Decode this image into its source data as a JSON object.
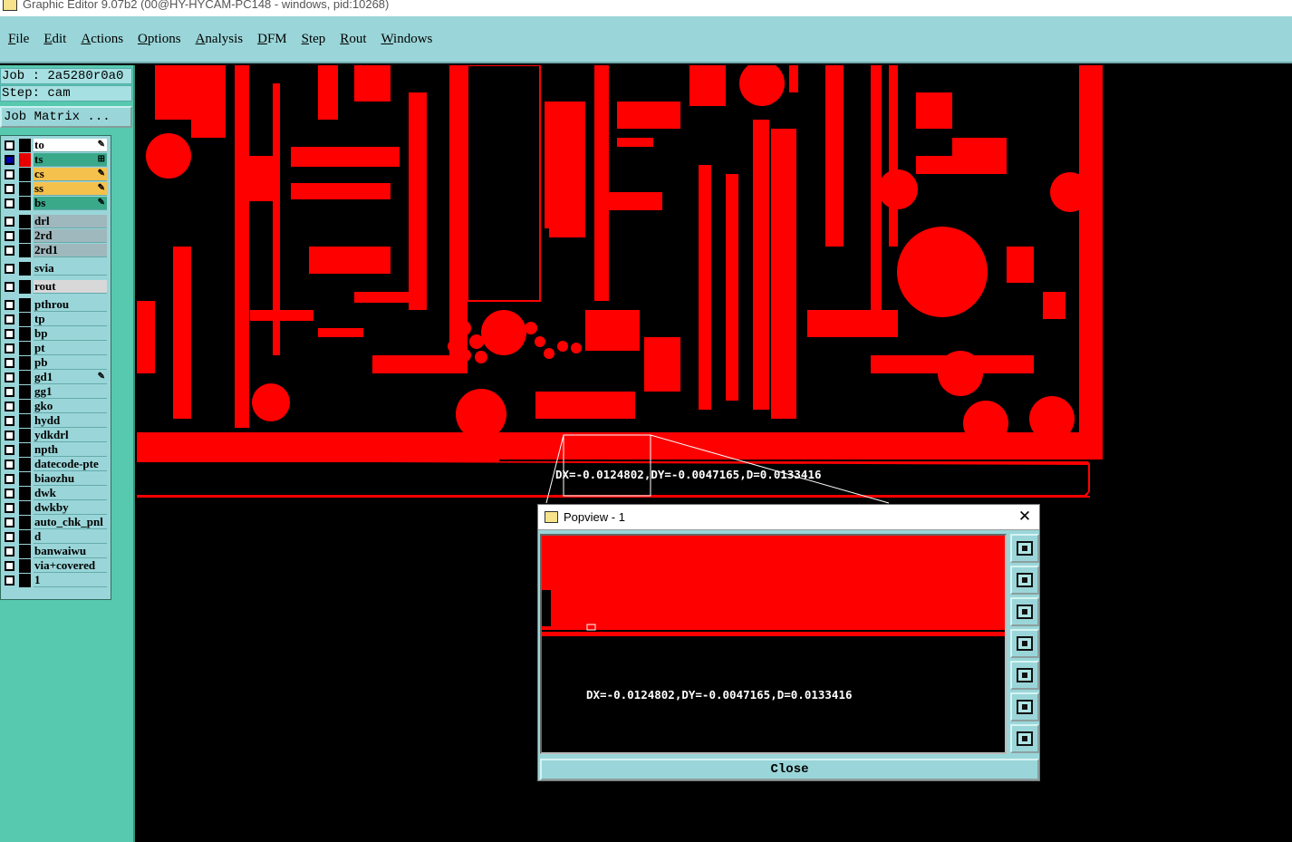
{
  "window": {
    "title": "Graphic Editor 9.07b2 (00@HY-HYCAM-PC148 - windows, pid:10268)"
  },
  "menu": [
    "File",
    "Edit",
    "Actions",
    "Options",
    "Analysis",
    "DFM",
    "Step",
    "Rout",
    "Windows"
  ],
  "job": {
    "job_line": "Job : 2a5280r0a0",
    "step_line": "Step: cam",
    "matrix_button": "Job Matrix ..."
  },
  "layers": [
    {
      "name": "to",
      "selected": false,
      "swatch": "black",
      "color": "#ffffff",
      "mark": "✎"
    },
    {
      "name": "ts",
      "selected": true,
      "swatch": "red",
      "color": "#3aa98a",
      "mark": "⊞"
    },
    {
      "name": "cs",
      "selected": false,
      "swatch": "black",
      "color": "#f5c14d",
      "mark": "✎"
    },
    {
      "name": "ss",
      "selected": false,
      "swatch": "black",
      "color": "#f5c14d",
      "mark": "✎"
    },
    {
      "name": "bs",
      "selected": false,
      "swatch": "black",
      "color": "#3aa98a",
      "mark": "✎"
    },
    {
      "name": "drl",
      "selected": false,
      "swatch": "black",
      "color": "#9fb8bd",
      "mark": ""
    },
    {
      "name": "2rd",
      "selected": false,
      "swatch": "black",
      "color": "#9fb8bd",
      "mark": ""
    },
    {
      "name": "2rd1",
      "selected": false,
      "swatch": "black",
      "color": "#9fb8bd",
      "mark": ""
    },
    {
      "name": "svia",
      "selected": false,
      "swatch": "black",
      "color": "#9ad6d9",
      "mark": ""
    },
    {
      "name": "rout",
      "selected": false,
      "swatch": "black",
      "color": "#d8d8d8",
      "mark": ""
    },
    {
      "name": "pthrou",
      "selected": false,
      "swatch": "black",
      "color": "#9ad6d9",
      "mark": ""
    },
    {
      "name": "tp",
      "selected": false,
      "swatch": "black",
      "color": "#9ad6d9",
      "mark": ""
    },
    {
      "name": "bp",
      "selected": false,
      "swatch": "black",
      "color": "#9ad6d9",
      "mark": ""
    },
    {
      "name": "pt",
      "selected": false,
      "swatch": "black",
      "color": "#9ad6d9",
      "mark": ""
    },
    {
      "name": "pb",
      "selected": false,
      "swatch": "black",
      "color": "#9ad6d9",
      "mark": ""
    },
    {
      "name": "gd1",
      "selected": false,
      "swatch": "black",
      "color": "#9ad6d9",
      "mark": "✎"
    },
    {
      "name": "gg1",
      "selected": false,
      "swatch": "black",
      "color": "#9ad6d9",
      "mark": ""
    },
    {
      "name": "gko",
      "selected": false,
      "swatch": "black",
      "color": "#9ad6d9",
      "mark": ""
    },
    {
      "name": "hydd",
      "selected": false,
      "swatch": "black",
      "color": "#9ad6d9",
      "mark": ""
    },
    {
      "name": "ydkdrl",
      "selected": false,
      "swatch": "black",
      "color": "#9ad6d9",
      "mark": ""
    },
    {
      "name": "npth",
      "selected": false,
      "swatch": "black",
      "color": "#9ad6d9",
      "mark": ""
    },
    {
      "name": "datecode-pte",
      "selected": false,
      "swatch": "black",
      "color": "#9ad6d9",
      "mark": ""
    },
    {
      "name": "biaozhu",
      "selected": false,
      "swatch": "black",
      "color": "#9ad6d9",
      "mark": ""
    },
    {
      "name": "dwk",
      "selected": false,
      "swatch": "black",
      "color": "#9ad6d9",
      "mark": ""
    },
    {
      "name": "dwkby",
      "selected": false,
      "swatch": "black",
      "color": "#9ad6d9",
      "mark": ""
    },
    {
      "name": "auto_chk_pnl",
      "selected": false,
      "swatch": "black",
      "color": "#9ad6d9",
      "mark": ""
    },
    {
      "name": "d",
      "selected": false,
      "swatch": "black",
      "color": "#9ad6d9",
      "mark": ""
    },
    {
      "name": "banwaiwu",
      "selected": false,
      "swatch": "black",
      "color": "#9ad6d9",
      "mark": ""
    },
    {
      "name": "via+covered",
      "selected": false,
      "swatch": "black",
      "color": "#9ad6d9",
      "mark": ""
    },
    {
      "name": "1",
      "selected": false,
      "swatch": "black",
      "color": "#9ad6d9",
      "mark": ""
    }
  ],
  "canvas": {
    "measure_text": "DX=-0.0124802,DY=-0.0047165,D=0.0133416",
    "copper_color": "#ff0000"
  },
  "popview": {
    "title": "Popview - 1",
    "close_x": "✕",
    "measure_text": "DX=-0.0124802,DY=-0.0047165,D=0.0133416",
    "tools": [
      "zoom-fit-icon",
      "pan-up-icon",
      "pan-down-icon",
      "pan-left-icon",
      "pan-right-icon",
      "zoom-in-icon",
      "zoom-out-icon"
    ],
    "close_label": "Close"
  }
}
